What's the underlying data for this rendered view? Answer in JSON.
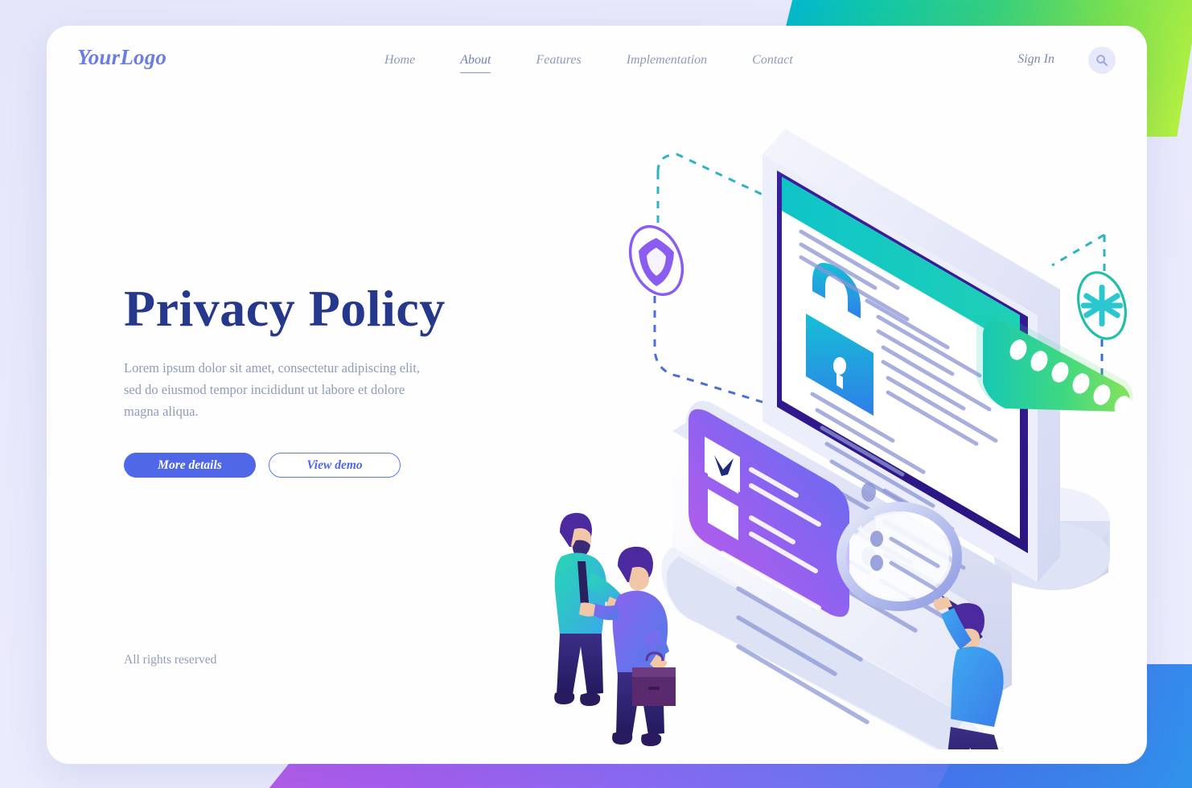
{
  "header": {
    "logo": "YourLogo",
    "nav": [
      {
        "label": "Home",
        "active": false
      },
      {
        "label": "About",
        "active": true
      },
      {
        "label": "Features",
        "active": false
      },
      {
        "label": "Implementation",
        "active": false
      },
      {
        "label": "Contact",
        "active": false
      }
    ],
    "signin_label": "Sign In",
    "search_icon": "search-icon"
  },
  "hero": {
    "title": "Privacy Policy",
    "subtitle": "Lorem ipsum dolor sit amet, consectetur adipiscing elit, sed do eiusmod tempor incididunt ut labore et dolore magna aliqua.",
    "primary_button": "More details",
    "secondary_button": "View demo"
  },
  "footer": {
    "rights": "All rights reserved"
  },
  "illustration": {
    "description": "Isometric privacy policy scene: tablet screen with padlock, document scroll with signature, consent checkbox card, password field, magnifying glass, shield badge, asterisk badge, two businessmen shaking hands and a person holding a magnifier",
    "icons": [
      {
        "name": "padlock-icon",
        "color": "#2f9fe8"
      },
      {
        "name": "shield-badge-icon",
        "color": "#8a5cf0"
      },
      {
        "name": "asterisk-badge-icon",
        "color": "#2fc3c0"
      },
      {
        "name": "checkbox-checked-icon",
        "color": "#1b2a7a"
      },
      {
        "name": "magnifier-icon",
        "color": "#a8b2e8"
      },
      {
        "name": "password-dots-icon",
        "color": "#ffffff"
      }
    ],
    "password_dots": 6
  },
  "colors": {
    "brand_blue": "#4f66e6",
    "title_navy": "#26388c",
    "muted_text": "#8e9cb9",
    "logo_blue": "#6a7ee0",
    "accent_teal": "#17c3b2",
    "accent_green": "#57d96d",
    "accent_purple": "#8a5cf0",
    "accent_magenta": "#b45ce8",
    "card_bg": "#fefeff",
    "page_bg": "#e8e9fb"
  }
}
